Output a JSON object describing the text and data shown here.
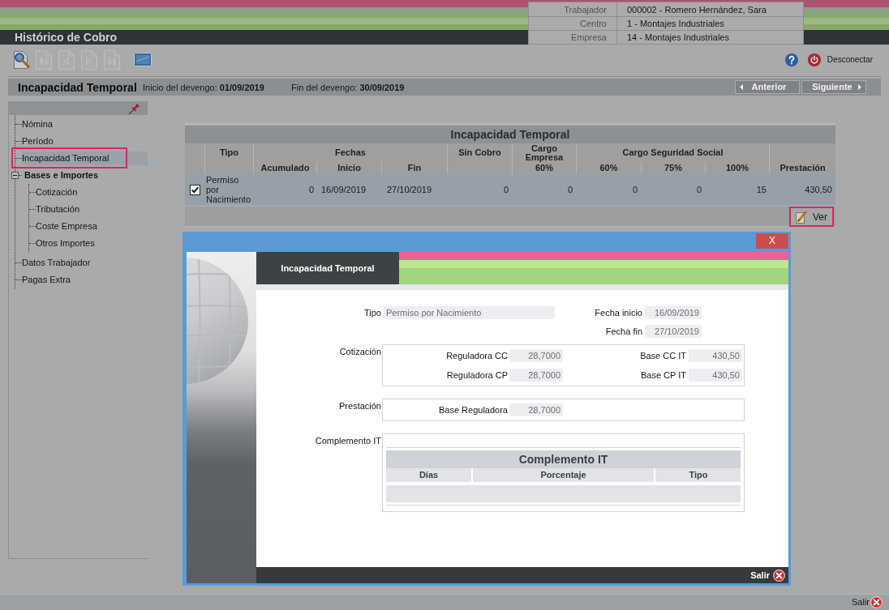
{
  "header": {
    "title": "Histórico de Cobro",
    "worker_info": [
      {
        "label": "Trabajador",
        "value": "000002 - Romero Hernández, Sara"
      },
      {
        "label": "Centro",
        "value": "1 - Montajes Industriales"
      },
      {
        "label": "Empresa",
        "value": "14 - Montajes Industriales"
      }
    ]
  },
  "toolbar": {
    "buttons": [
      {
        "kind": "search",
        "disabled": false
      },
      {
        "kind": "first",
        "disabled": true
      },
      {
        "kind": "previous",
        "disabled": true
      },
      {
        "kind": "next",
        "disabled": true
      },
      {
        "kind": "last",
        "disabled": true
      },
      {
        "kind": "screen",
        "disabled": false
      }
    ],
    "logout": "Desconectar"
  },
  "title_bar": {
    "title": "Incapacidad Temporal",
    "period": [
      {
        "label": "Inicio del devengo:",
        "value": "01/09/2019"
      },
      {
        "label": "Fin del devengo:",
        "value": "30/09/2019"
      }
    ],
    "nav": [
      {
        "kind": "previous",
        "label": "Anterior",
        "disabled": true
      },
      {
        "kind": "next",
        "label": "Siguiente",
        "disabled": true
      }
    ]
  },
  "sidebar": {
    "items": [
      {
        "label": "Nómina",
        "selected": false,
        "highlighted": false
      },
      {
        "label": "Período",
        "selected": false,
        "highlighted": false
      },
      {
        "label": "Incapacidad Temporal",
        "selected": true,
        "highlighted": true
      },
      {
        "label": "Bases e Importes",
        "selected": false,
        "highlighted": false,
        "expanded": true,
        "children": [
          {
            "label": "Cotización",
            "selected": false,
            "highlighted": false
          },
          {
            "label": "Tributación",
            "selected": false,
            "highlighted": false
          },
          {
            "label": "Coste Empresa",
            "selected": false,
            "highlighted": false
          },
          {
            "label": "Otros Importes",
            "selected": false,
            "highlighted": false
          }
        ]
      },
      {
        "label": "Datos Trabajador",
        "selected": false,
        "highlighted": false
      },
      {
        "label": "Pagas Extra",
        "selected": false,
        "highlighted": false
      }
    ]
  },
  "table": {
    "title": "Incapacidad Temporal",
    "column_groups": [
      {
        "label": "Tipo",
        "columns": [
          {}
        ]
      },
      {
        "label": "Fechas",
        "columns": [
          {
            "label": "Acumulado"
          },
          {
            "label": "Inicio"
          },
          {
            "label": "Fin"
          }
        ]
      },
      {
        "label": "Sin Cobro",
        "columns": [
          {}
        ]
      },
      {
        "label": "Cargo Empresa",
        "columns": [
          {
            "label": "60%"
          }
        ]
      },
      {
        "label": "Cargo Seguridad Social",
        "columns": [
          {
            "label": "60%"
          },
          {
            "label": "75%"
          },
          {
            "label": "100%"
          }
        ]
      },
      {
        "columns": [
          {
            "label": "Prestación"
          }
        ]
      }
    ],
    "rows": [
      {
        "selected": true,
        "checked": true,
        "cells": [
          "Permiso por Nacimiento",
          "0",
          "16/09/2019",
          "27/10/2019",
          "0",
          "0",
          "0",
          "0",
          "15",
          "430,50"
        ]
      }
    ],
    "actions": [
      {
        "label": "Ver",
        "highlighted": true
      }
    ]
  },
  "dialog": {
    "close_label": "X",
    "title": "Incapacidad Temporal",
    "tipo": {
      "label": "Tipo",
      "value": "Permiso por Nacimiento"
    },
    "dates": [
      {
        "label": "Fecha inicio",
        "value": "16/09/2019"
      },
      {
        "label": "Fecha fin",
        "value": "27/10/2019"
      }
    ],
    "sections": [
      {
        "kind": "fields",
        "label": "Cotización",
        "fields": [
          {
            "label": "Reguladora CC",
            "value": "28,7000"
          },
          {
            "label": "Base CC IT",
            "value": "430,50"
          },
          {
            "label": "Reguladora CP",
            "value": "28,7000"
          },
          {
            "label": "Base CP IT",
            "value": "430,50"
          }
        ]
      },
      {
        "kind": "fields",
        "label": "Prestación",
        "fields": [
          {
            "label": "Base Reguladora",
            "value": "28,7000"
          }
        ]
      },
      {
        "kind": "table",
        "label": "Complemento IT",
        "table": {
          "title": "Complemento IT",
          "columns": [
            "Días",
            "Porcentaje",
            "Tipo"
          ]
        }
      }
    ],
    "footer_button": "Salir"
  },
  "status_bar": {
    "exit": "Salir"
  }
}
